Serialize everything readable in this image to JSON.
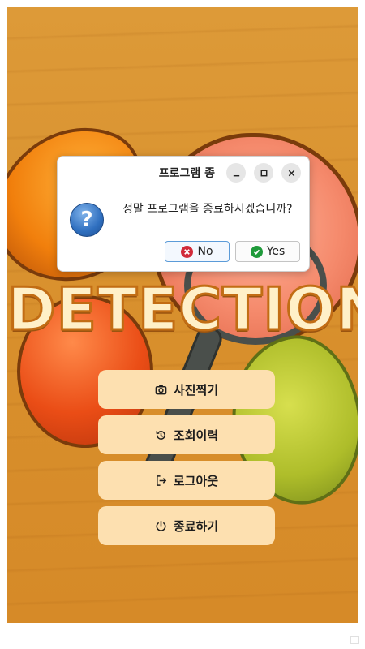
{
  "app": {
    "logo_text": "DETECTION",
    "menu": [
      {
        "label": "사진찍기",
        "icon": "camera-icon"
      },
      {
        "label": "조회이력",
        "icon": "history-icon"
      },
      {
        "label": "로그아웃",
        "icon": "logout-icon"
      },
      {
        "label": "종료하기",
        "icon": "power-icon"
      }
    ]
  },
  "dialog": {
    "title": "프로그램 종",
    "message": "정말 프로그램을 종료하시겠습니까?",
    "icon": "question-icon",
    "buttons": {
      "no_mnemonic": "N",
      "no_rest": "o",
      "yes_mnemonic": "Y",
      "yes_rest": "es"
    }
  }
}
